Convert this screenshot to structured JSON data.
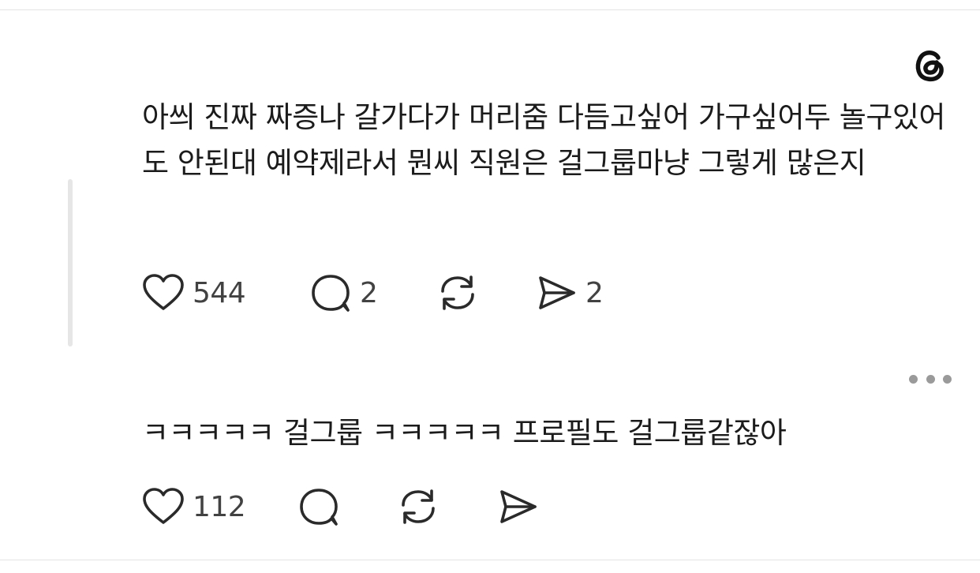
{
  "post": {
    "text": "아씌 진짜 짜증나 갈가다가 머리줌 다듬고싶어 가구싶어두 놀구있어도 안된대 예약제라서 뭔씨 직원은 걸그룹마냥 그렇게 많은지",
    "likes": "544",
    "replies": "2",
    "shares": "2"
  },
  "reply": {
    "text": "ㅋㅋㅋㅋㅋ 걸그룹 ㅋㅋㅋㅋㅋ 프로필도 걸그룹같잖아",
    "likes": "112"
  },
  "icons": {
    "logo": "threads-logo",
    "like": "heart-icon",
    "reply": "speech-bubble-icon",
    "repost": "repost-icon",
    "share": "paper-plane-icon",
    "more": "more-dots-icon"
  }
}
